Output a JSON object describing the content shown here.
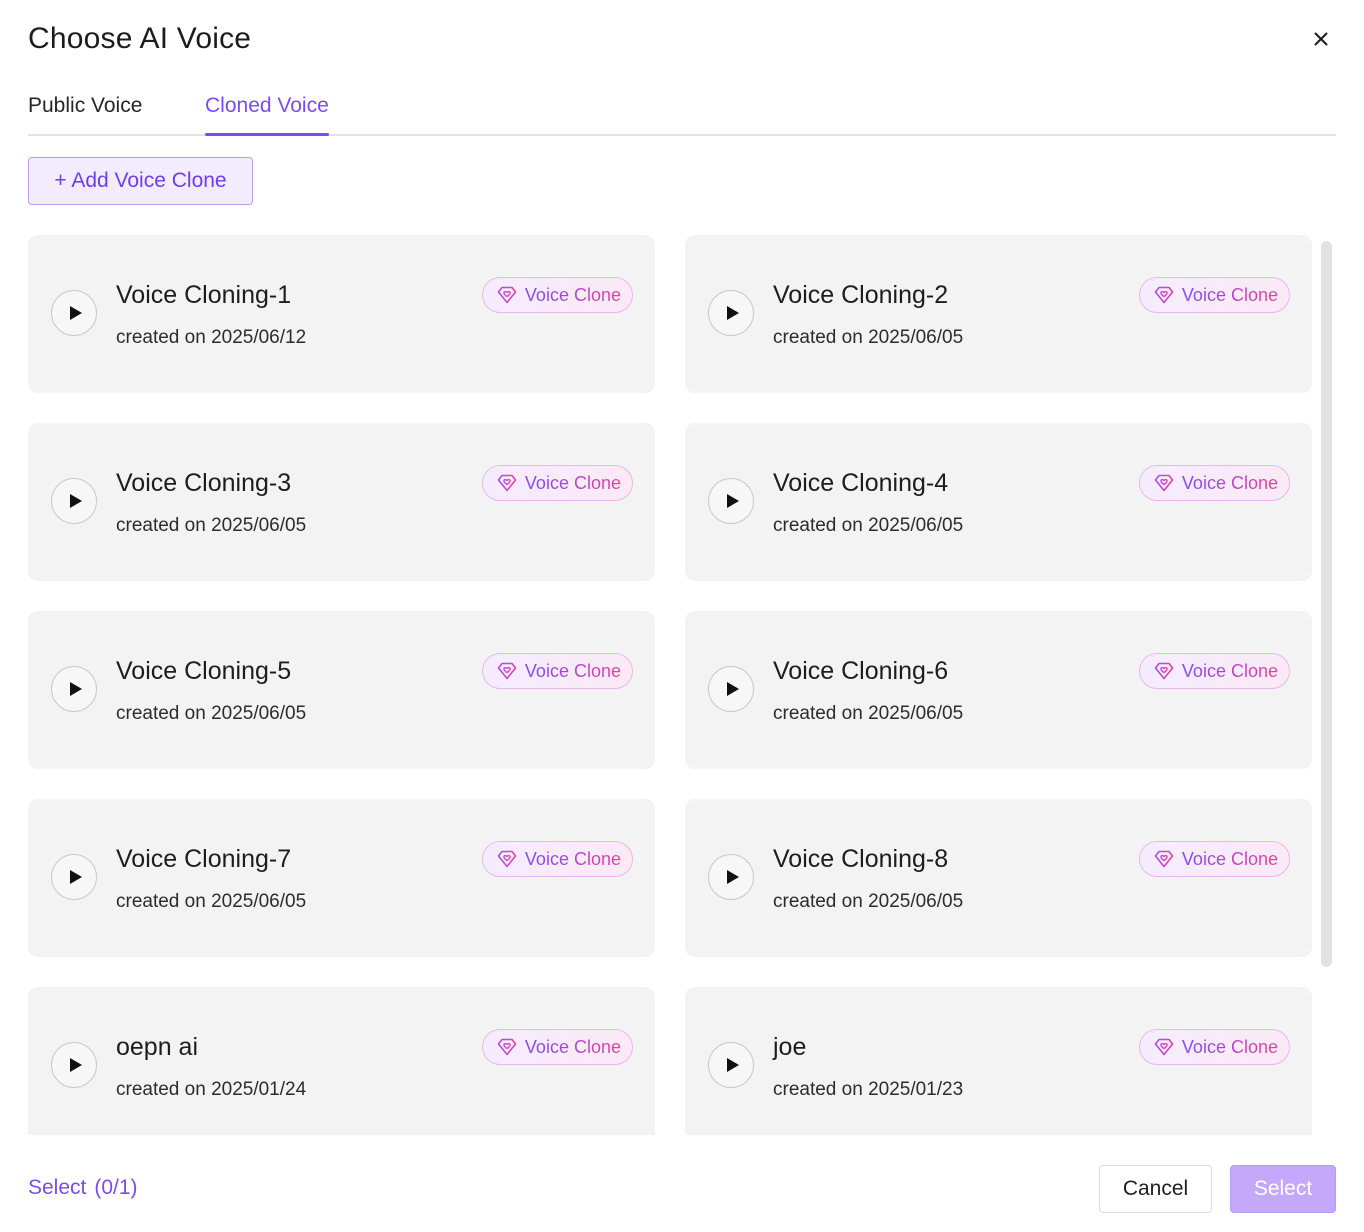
{
  "dialog": {
    "title": "Choose AI Voice",
    "close_icon": "close-icon"
  },
  "tabs": [
    {
      "label": "Public Voice",
      "active": false
    },
    {
      "label": "Cloned Voice",
      "active": true
    }
  ],
  "add_button": {
    "label": "+ Add Voice Clone"
  },
  "voices": [
    {
      "name": "Voice Cloning-1",
      "date": "created on 2025/06/12",
      "badge": "Voice Clone"
    },
    {
      "name": "Voice Cloning-2",
      "date": "created on 2025/06/05",
      "badge": "Voice Clone"
    },
    {
      "name": "Voice Cloning-3",
      "date": "created on 2025/06/05",
      "badge": "Voice Clone"
    },
    {
      "name": "Voice Cloning-4",
      "date": "created on 2025/06/05",
      "badge": "Voice Clone"
    },
    {
      "name": "Voice Cloning-5",
      "date": "created on 2025/06/05",
      "badge": "Voice Clone"
    },
    {
      "name": "Voice Cloning-6",
      "date": "created on 2025/06/05",
      "badge": "Voice Clone"
    },
    {
      "name": "Voice Cloning-7",
      "date": "created on 2025/06/05",
      "badge": "Voice Clone"
    },
    {
      "name": "Voice Cloning-8",
      "date": "created on 2025/06/05",
      "badge": "Voice Clone"
    },
    {
      "name": "oepn ai",
      "date": "created on 2025/01/24",
      "badge": "Voice Clone"
    },
    {
      "name": "joe",
      "date": "created on 2025/01/23",
      "badge": "Voice Clone"
    }
  ],
  "footer": {
    "select_label": "Select",
    "select_count": "(0/1)",
    "cancel_label": "Cancel",
    "confirm_label": "Select"
  },
  "colors": {
    "accent": "#7a4cf0",
    "card_bg": "#f3f3f3",
    "badge_gradient_start": "#7f4df0",
    "badge_gradient_end": "#e2449e",
    "select_button_bg": "#c4a9fb"
  }
}
